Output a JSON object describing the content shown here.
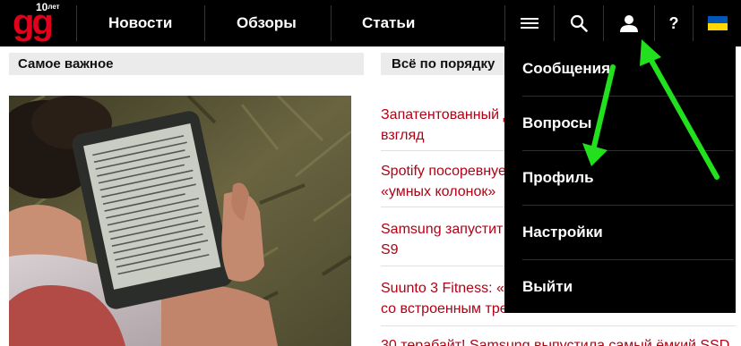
{
  "header": {
    "logo_text": "gg",
    "logo_badge": "10",
    "logo_badge_mark": "лет",
    "nav": [
      "Новости",
      "Обзоры",
      "Статьи"
    ],
    "icons": [
      "menu-icon",
      "search-icon",
      "user-icon",
      "help-icon",
      "ukraine-flag-icon"
    ],
    "help_label": "?"
  },
  "sections": {
    "important": "Самое важное",
    "all": "Всё по порядку"
  },
  "news": [
    [
      "Запатентованный д",
      "взгляд"
    ],
    [
      "Spotify посоревнуе",
      "«умных колонок»"
    ],
    [
      "Samsung запустит",
      "S9"
    ],
    [
      "Suunto 3 Fitness: «",
      "со встроенным трен"
    ],
    [
      "30 терабайт! Samsung выпустила самый ёмкий SSD"
    ]
  ],
  "dropdown": [
    "Сообщения",
    "Вопросы",
    "Профиль",
    "Настройки",
    "Выйти"
  ],
  "colors": {
    "brand_red": "#e2001a",
    "link_red": "#b30014",
    "annotation_green": "#22e01e",
    "flag_blue": "#0057b7",
    "flag_yellow": "#ffd700"
  }
}
